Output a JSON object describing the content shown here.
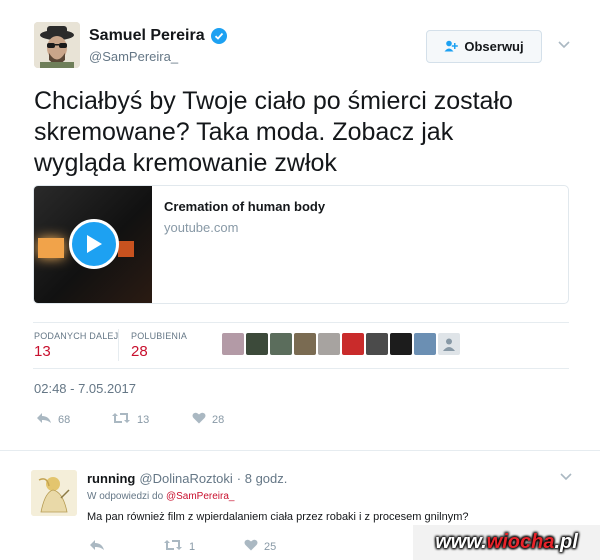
{
  "author": {
    "name": "Samuel Pereira",
    "handle": "@SamPereira_",
    "verified": true
  },
  "follow_button": {
    "label": "Obserwuj",
    "icon": "add-user-icon"
  },
  "tweet": {
    "line1": "Chciałbyś by Twoje ciało po śmierci zostało",
    "line2": "skremowane? Taka moda. Zobacz jak",
    "line3": "wygląda kremowanie zwłok"
  },
  "card": {
    "title": "Cremation of human body",
    "domain": "youtube.com"
  },
  "stats": {
    "retweets_label": "PODANYCH DALEJ",
    "retweets_value": "13",
    "likes_label": "POLUBIENIA",
    "likes_value": "28"
  },
  "timestamp": "02:48 - 7.05.2017",
  "actions": {
    "reply_count": "68",
    "retweet_count": "13",
    "like_count": "28"
  },
  "reply": {
    "name": "running",
    "handle": "@DolinaRoztoki",
    "time": "· 8 godz.",
    "in_reply_prefix": "W odpowiedzi do",
    "in_reply_handle": "@SamPereira_",
    "text": "Ma pan również  film z wpierdalaniem ciała przez robaki i z procesem gnilnym?",
    "reply_icon": "reply-icon",
    "retweet_count": "1",
    "like_count": "25"
  },
  "watermark": {
    "prefix": "www.",
    "name": "wiocha",
    "suffix": ".pl"
  },
  "colors": {
    "accent_red": "#c8102e",
    "twitter_blue": "#1da1f2",
    "muted": "#657786"
  }
}
